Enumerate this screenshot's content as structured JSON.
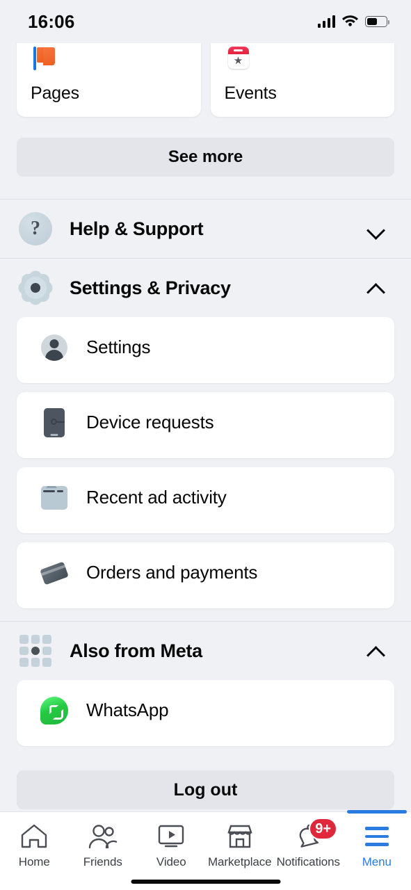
{
  "status_bar": {
    "time": "16:06",
    "signal_icon": "signal-bars-icon",
    "wifi_icon": "wifi-icon",
    "battery_icon": "battery-icon",
    "battery_level_pct": 55
  },
  "shortcuts": {
    "cards": [
      {
        "label": "Pages",
        "icon": "pages-flag-icon"
      },
      {
        "label": "Events",
        "icon": "events-calendar-icon"
      }
    ],
    "see_more_label": "See more"
  },
  "sections": [
    {
      "id": "help-support",
      "title": "Help & Support",
      "icon": "question-mark-circle-icon",
      "chevron": "chevron-down-icon",
      "expanded": false,
      "items": []
    },
    {
      "id": "settings-privacy",
      "title": "Settings & Privacy",
      "icon": "gear-icon",
      "chevron": "chevron-up-icon",
      "expanded": true,
      "items": [
        {
          "label": "Settings",
          "icon": "avatar-person-icon"
        },
        {
          "label": "Device requests",
          "icon": "phone-key-icon"
        },
        {
          "label": "Recent ad activity",
          "icon": "ad-image-icon"
        },
        {
          "label": "Orders and payments",
          "icon": "payment-card-icon"
        }
      ]
    },
    {
      "id": "also-from-meta",
      "title": "Also from Meta",
      "icon": "app-grid-icon",
      "chevron": "chevron-up-icon",
      "expanded": true,
      "items": [
        {
          "label": "WhatsApp",
          "icon": "whatsapp-icon"
        }
      ]
    }
  ],
  "logout": {
    "label": "Log out"
  },
  "bottom_nav": {
    "items": [
      {
        "label": "Home",
        "icon": "home-icon",
        "active": false,
        "badge": null
      },
      {
        "label": "Friends",
        "icon": "friends-icon",
        "active": false,
        "badge": null
      },
      {
        "label": "Video",
        "icon": "video-icon",
        "active": false,
        "badge": null
      },
      {
        "label": "Marketplace",
        "icon": "marketplace-icon",
        "active": false,
        "badge": null
      },
      {
        "label": "Notifications",
        "icon": "bell-icon",
        "active": false,
        "badge": "9+"
      },
      {
        "label": "Menu",
        "icon": "hamburger-menu-icon",
        "active": true,
        "badge": null
      }
    ]
  },
  "colors": {
    "page_background": "#eff1f5",
    "card_background": "#ffffff",
    "accent_blue": "#2b7ce0",
    "badge_red": "#e0283c",
    "button_gray": "#e3e5ea",
    "whatsapp_green": "#25d366"
  }
}
